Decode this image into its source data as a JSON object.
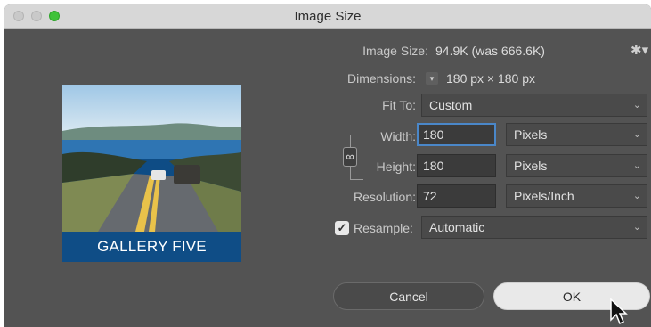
{
  "window": {
    "title": "Image Size"
  },
  "preview": {
    "banner_text": "GALLERY FIVE"
  },
  "info": {
    "image_size_label": "Image Size:",
    "image_size_value": "94.9K (was 666.6K)",
    "dimensions_label": "Dimensions:",
    "dimensions_value": "180 px × 180 px"
  },
  "fit_to": {
    "label": "Fit To:",
    "value": "Custom"
  },
  "width": {
    "label": "Width:",
    "value": "180",
    "unit": "Pixels"
  },
  "height": {
    "label": "Height:",
    "value": "180",
    "unit": "Pixels"
  },
  "resolution": {
    "label": "Resolution:",
    "value": "72",
    "unit": "Pixels/Inch"
  },
  "resample": {
    "label": "Resample:",
    "checked": true,
    "value": "Automatic"
  },
  "buttons": {
    "cancel": "Cancel",
    "ok": "OK"
  },
  "icons": {
    "gear": "gear-icon",
    "link": "chain-link-icon",
    "check": "checkmark-icon",
    "chevron": "chevron-down-icon",
    "cursor": "mouse-pointer-icon"
  },
  "colors": {
    "dialog_bg": "#535353",
    "focus_ring": "#4a87c9",
    "banner_bg": "#0f4d86",
    "zoom_button": "#3fc23a"
  }
}
